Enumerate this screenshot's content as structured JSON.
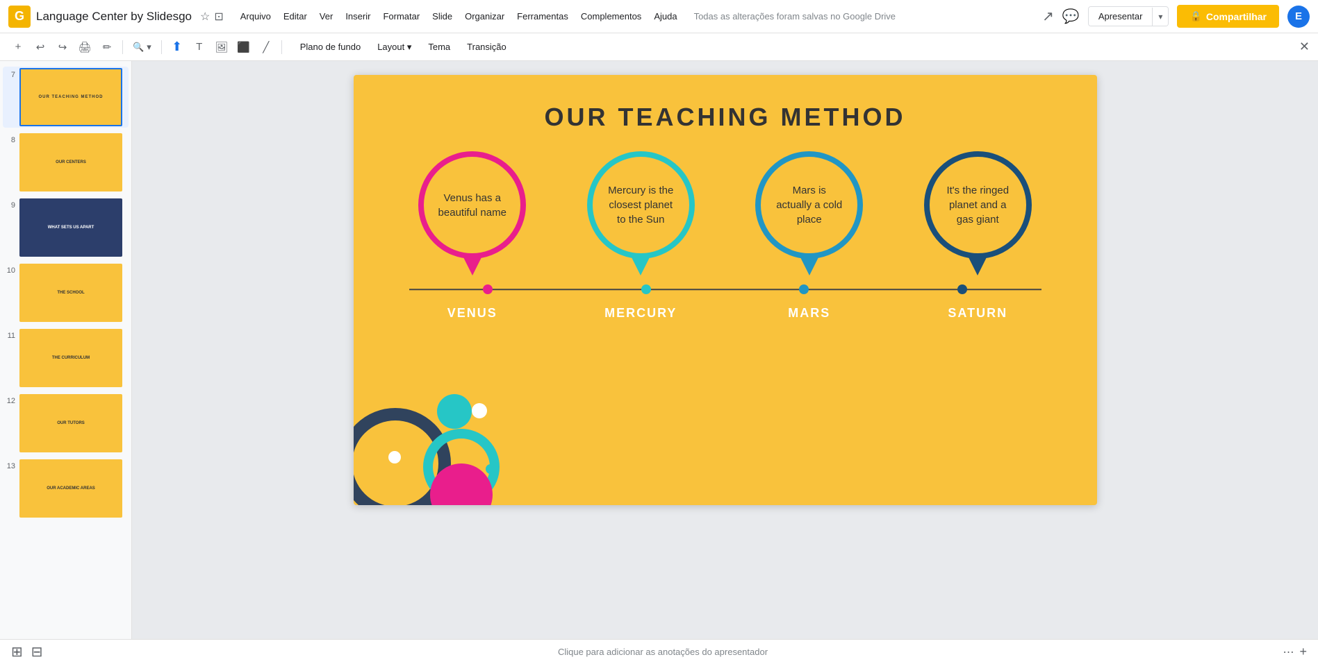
{
  "app": {
    "logo_letter": "G",
    "title": "Language Center by Slidesgo",
    "save_status": "Todas as alterações foram salvas no Google Drive"
  },
  "menu": {
    "items": [
      "Arquivo",
      "Editar",
      "Ver",
      "Inserir",
      "Formatar",
      "Slide",
      "Organizar",
      "Ferramentas",
      "Complementos",
      "Ajuda"
    ]
  },
  "toolbar": {
    "zoom_label": "▾",
    "layout_label": "Layout",
    "layout_arrow": "▾",
    "theme_label": "Tema",
    "transition_label": "Transição",
    "background_label": "Plano de fundo"
  },
  "slide": {
    "title": "OUR TEACHING METHOD",
    "planets": [
      {
        "id": "venus",
        "label": "VENUS",
        "description": "Venus has a beautiful name",
        "color": "#e91e8c",
        "dot_color": "#e91e8c"
      },
      {
        "id": "mercury",
        "label": "MERCURY",
        "description": "Mercury is the closest planet to the Sun",
        "color": "#26c6c6",
        "dot_color": "#26c6c6"
      },
      {
        "id": "mars",
        "label": "MARS",
        "description": "Mars is actually a cold place",
        "color": "#2196c4",
        "dot_color": "#2196c4"
      },
      {
        "id": "saturn",
        "label": "SATURN",
        "description": "It's the ringed planet and a gas giant",
        "color": "#1a4f7a",
        "dot_color": "#1a4f7a"
      }
    ]
  },
  "slides_panel": {
    "slides": [
      {
        "num": "7",
        "active": true,
        "bg": "#f9c23c"
      },
      {
        "num": "8",
        "active": false,
        "bg": "#f9c23c"
      },
      {
        "num": "9",
        "active": false,
        "bg": "#2c3e6b"
      },
      {
        "num": "10",
        "active": false,
        "bg": "#f9c23c"
      },
      {
        "num": "11",
        "active": false,
        "bg": "#f9c23c"
      },
      {
        "num": "12",
        "active": false,
        "bg": "#f9c23c"
      },
      {
        "num": "13",
        "active": false,
        "bg": "#f9c23c"
      }
    ]
  },
  "notes": {
    "placeholder": "Clique para adicionar as anotações do apresentador"
  },
  "present_button": "Apresentar",
  "share_button": "Compartilhar",
  "share_icon": "🔒"
}
